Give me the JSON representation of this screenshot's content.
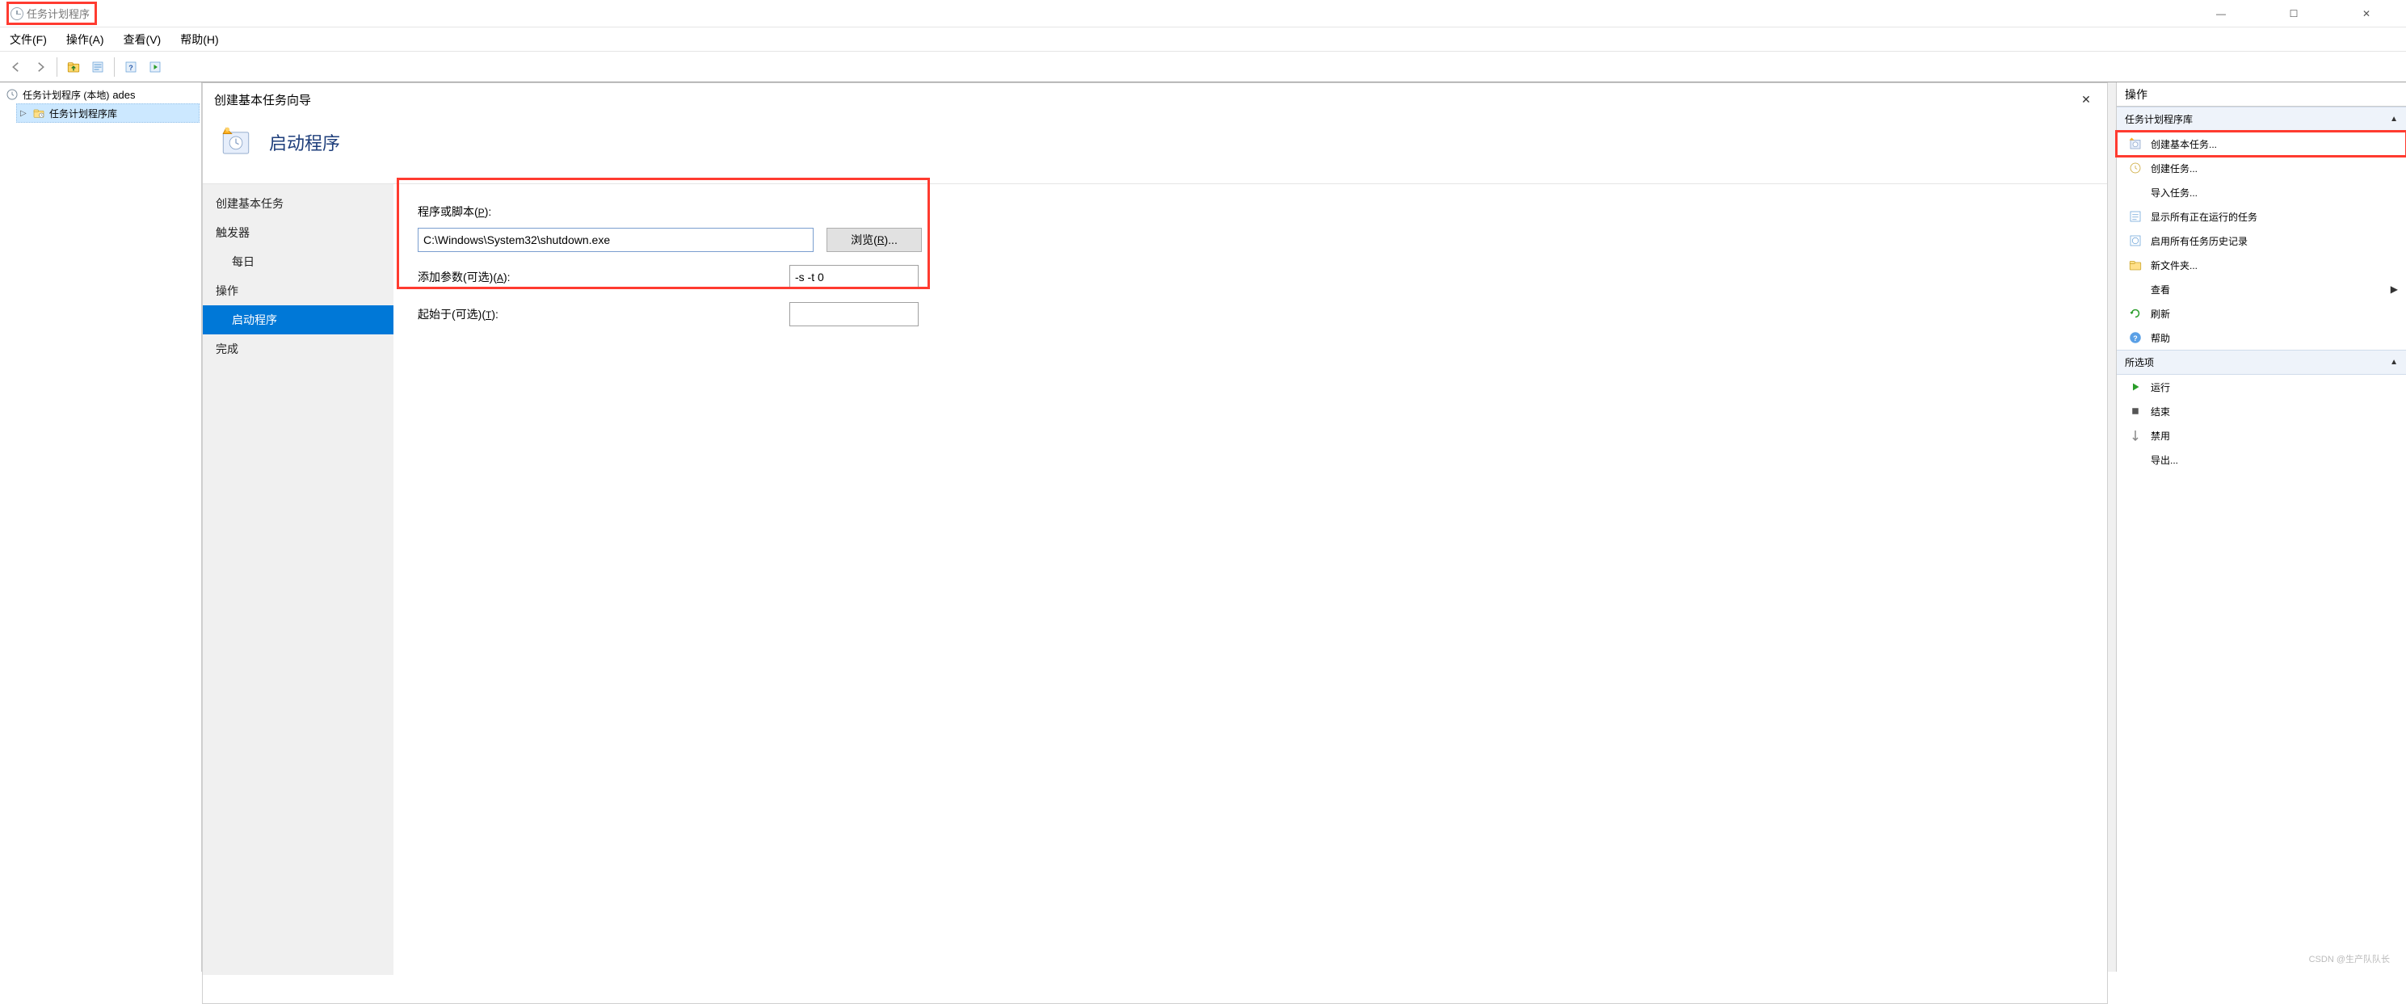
{
  "window": {
    "title": "任务计划程序",
    "minimize": "—",
    "maximize": "☐",
    "close": "✕"
  },
  "menubar": {
    "file": "文件(F)",
    "action": "操作(A)",
    "view": "查看(V)",
    "help": "帮助(H)"
  },
  "tree": {
    "root": "任务计划程序 (本地)",
    "library": "任务计划程序库"
  },
  "wizard": {
    "title": "创建基本任务向导",
    "hero": "启动程序",
    "nav": {
      "createBasic": "创建基本任务",
      "trigger": "触发器",
      "daily": "每日",
      "operation": "操作",
      "startProgram": "启动程序",
      "finish": "完成"
    },
    "form": {
      "programLabel": "程序或脚本(P):",
      "programValue": "C:\\Windows\\System32\\shutdown.exe",
      "browse": "浏览(R)...",
      "addArgsLabel": "添加参数(可选)(A):",
      "addArgsValue": "-s -t 0",
      "startInLabel": "起始于(可选)(T):",
      "startInValue": ""
    }
  },
  "actions": {
    "header": "操作",
    "sectionLibrary": "任务计划程序库",
    "items1": {
      "createBasic": "创建基本任务...",
      "createTask": "创建任务...",
      "importTask": "导入任务...",
      "showRunning": "显示所有正在运行的任务",
      "enableHistory": "启用所有任务历史记录",
      "newFolder": "新文件夹...",
      "view": "查看",
      "refresh": "刷新",
      "help": "帮助"
    },
    "sectionSelected": "所选项",
    "items2": {
      "run": "运行",
      "end": "结束",
      "disable": "禁用",
      "export": "导出..."
    }
  },
  "watermark": "CSDN @生产队队长"
}
